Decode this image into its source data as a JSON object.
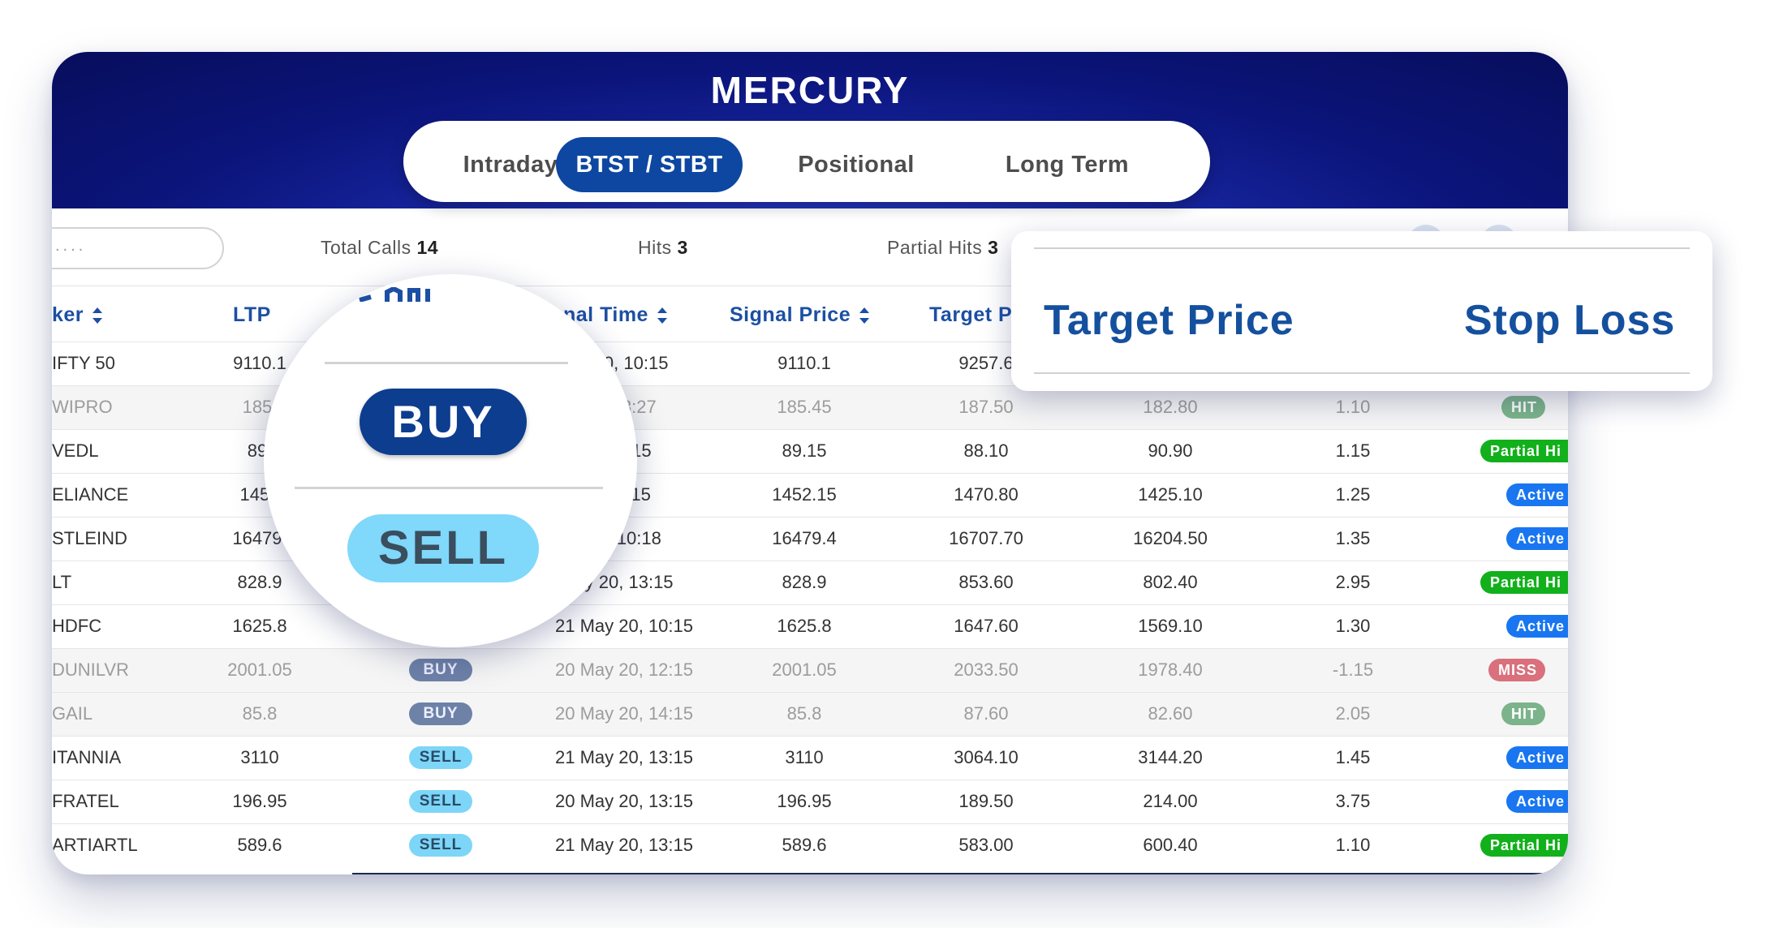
{
  "app": {
    "title": "MERCURY"
  },
  "tabs": [
    {
      "label": "Intraday",
      "active": false
    },
    {
      "label": "BTST / STBT",
      "active": true
    },
    {
      "label": "Positional",
      "active": false
    },
    {
      "label": "Long Term",
      "active": false
    }
  ],
  "search": {
    "placeholder": "...."
  },
  "stats": {
    "total_calls_label": "Total Calls",
    "total_calls": "14",
    "hits_label": "Hits",
    "hits": "3",
    "partial_hits_label": "Partial Hits",
    "partial_hits": "3"
  },
  "columns": {
    "ticker": "ker",
    "ltp": "LTP",
    "signal_time": "nal Time",
    "signal_price": "Signal Price",
    "target": "Target P"
  },
  "rows": [
    {
      "ticker": "IFTY 50",
      "ltp": "9110.1",
      "signal": "",
      "time": "y 20, 10:15",
      "price": "9110.1",
      "target": "9257.6",
      "stop": "",
      "ratio": "",
      "status": "",
      "dim": false
    },
    {
      "ticker": "WIPRO",
      "ltp": "185.",
      "signal": "",
      "time": "0, 13:27",
      "price": "185.45",
      "target": "187.50",
      "stop": "182.80",
      "ratio": "1.10",
      "status": "HIT",
      "dim": true
    },
    {
      "ticker": "VEDL",
      "ltp": "89.",
      "signal": "",
      "time": ", 10:15",
      "price": "89.15",
      "target": "88.10",
      "stop": "90.90",
      "ratio": "1.15",
      "status": "Partial Hi",
      "dim": false
    },
    {
      "ticker": "ELIANCE",
      "ltp": "1452",
      "signal": "",
      "time": ", 11:15",
      "price": "1452.15",
      "target": "1470.80",
      "stop": "1425.10",
      "ratio": "1.25",
      "status": "Active",
      "dim": false
    },
    {
      "ticker": "STLEIND",
      "ltp": "16479.",
      "signal": "",
      "time": "20, 10:18",
      "price": "16479.4",
      "target": "16707.70",
      "stop": "16204.50",
      "ratio": "1.35",
      "status": "Active",
      "dim": false
    },
    {
      "ticker": "LT",
      "ltp": "828.9",
      "signal": "",
      "time": "ay 20, 13:15",
      "price": "828.9",
      "target": "853.60",
      "stop": "802.40",
      "ratio": "2.95",
      "status": "Partial Hi",
      "dim": false
    },
    {
      "ticker": "HDFC",
      "ltp": "1625.8",
      "signal": "",
      "time": "21 May 20, 10:15",
      "price": "1625.8",
      "target": "1647.60",
      "stop": "1569.10",
      "ratio": "1.30",
      "status": "Active",
      "dim": false
    },
    {
      "ticker": "DUNILVR",
      "ltp": "2001.05",
      "signal": "BUY",
      "time": "20 May 20, 12:15",
      "price": "2001.05",
      "target": "2033.50",
      "stop": "1978.40",
      "ratio": "-1.15",
      "status": "MISS",
      "dim": true
    },
    {
      "ticker": "GAIL",
      "ltp": "85.8",
      "signal": "BUY",
      "time": "20 May 20, 14:15",
      "price": "85.8",
      "target": "87.60",
      "stop": "82.60",
      "ratio": "2.05",
      "status": "HIT",
      "dim": true
    },
    {
      "ticker": "ITANNIA",
      "ltp": "3110",
      "signal": "SELL",
      "time": "21 May 20, 13:15",
      "price": "3110",
      "target": "3064.10",
      "stop": "3144.20",
      "ratio": "1.45",
      "status": "Active",
      "dim": false
    },
    {
      "ticker": "FRATEL",
      "ltp": "196.95",
      "signal": "SELL",
      "time": "20 May 20, 13:15",
      "price": "196.95",
      "target": "189.50",
      "stop": "214.00",
      "ratio": "3.75",
      "status": "Active",
      "dim": false
    },
    {
      "ticker": "ARTIARTL",
      "ltp": "589.6",
      "signal": "SELL",
      "time": "21 May 20, 13:15",
      "price": "589.6",
      "target": "583.00",
      "stop": "600.40",
      "ratio": "1.10",
      "status": "Partial Hi",
      "dim": false
    }
  ],
  "zoom_overlay": {
    "target_label": "Target Price",
    "stop_label": "Stop Loss"
  },
  "magnifier": {
    "buy_label": "BUY",
    "sell_label": "SELL"
  },
  "colors": {
    "header": "#0b147a",
    "accent": "#0d47a1",
    "heading_text": "#1c4fa3",
    "buy": "#0d3d8f",
    "sell": "#7dd6f7",
    "active": "#1976f0",
    "partial": "#12b01b",
    "hit": "#7bb48a",
    "miss": "#d9707c"
  }
}
